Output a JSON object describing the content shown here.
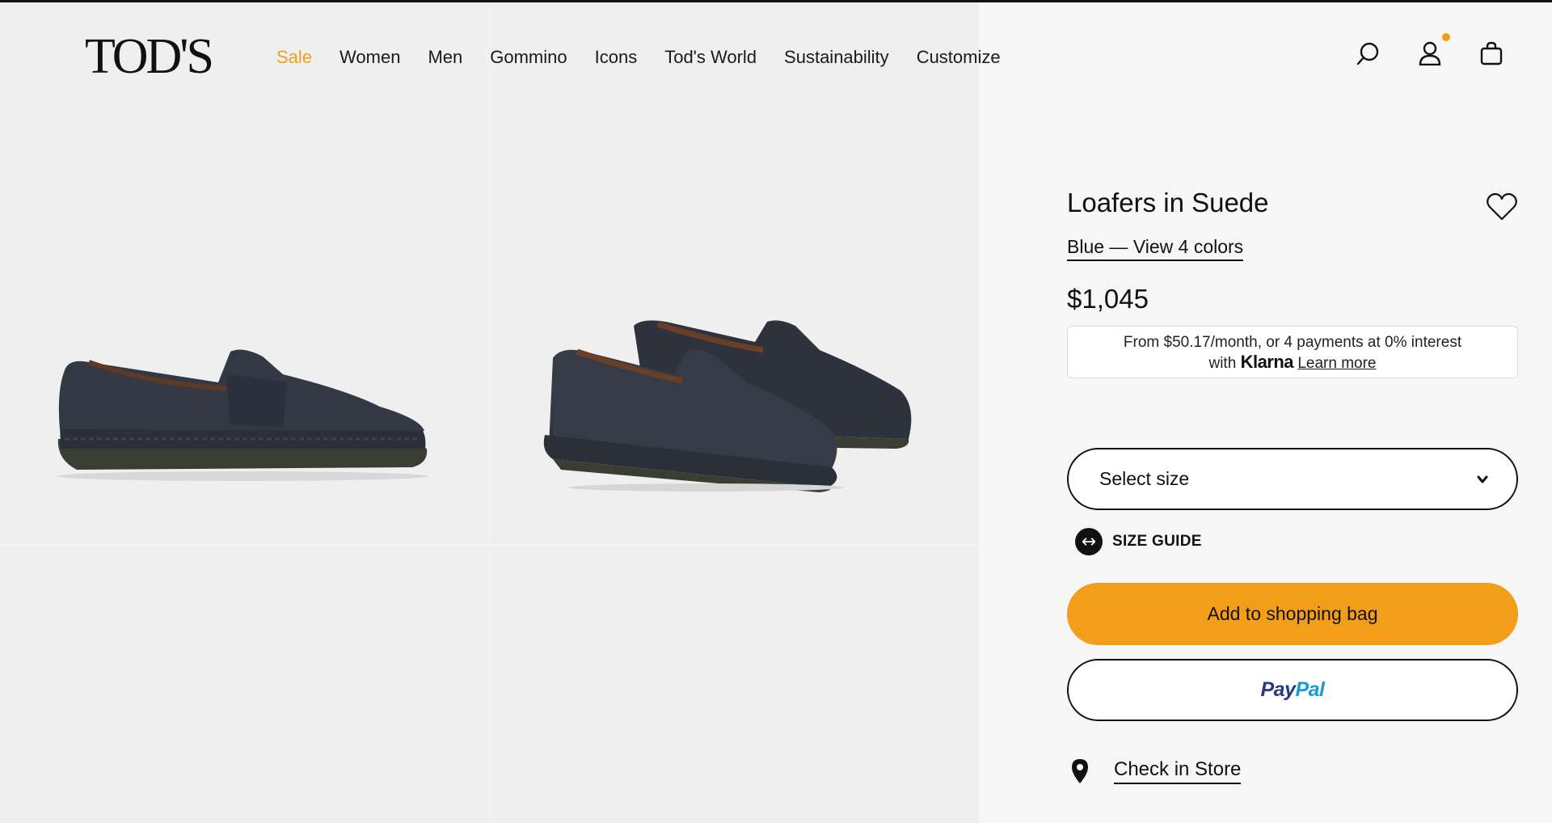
{
  "header": {
    "logo": "TOD'S",
    "nav": [
      "Sale",
      "Women",
      "Men",
      "Gommino",
      "Icons",
      "Tod's World",
      "Sustainability",
      "Customize"
    ],
    "icons": [
      "search-icon",
      "account-icon",
      "shopping-bag-icon"
    ]
  },
  "product": {
    "title": "Loafers in Suede",
    "color_link": "Blue — View 4 colors",
    "price": "$1,045",
    "klarna": {
      "text": "From $50.17/month, or 4 payments at 0% interest",
      "with": "with",
      "brand": "Klarna",
      "learn_more": "Learn more"
    },
    "size_select_label": "Select size",
    "size_guide_label": "SIZE GUIDE",
    "add_to_bag_label": "Add to shopping bag",
    "paypal": {
      "pay": "Pay",
      "pal": "Pal"
    },
    "check_store_label": "Check in Store"
  },
  "colors": {
    "accent": "#f29e19",
    "text": "#111111",
    "background": "#f6f6f6",
    "gallery_tile": "#efefef"
  }
}
